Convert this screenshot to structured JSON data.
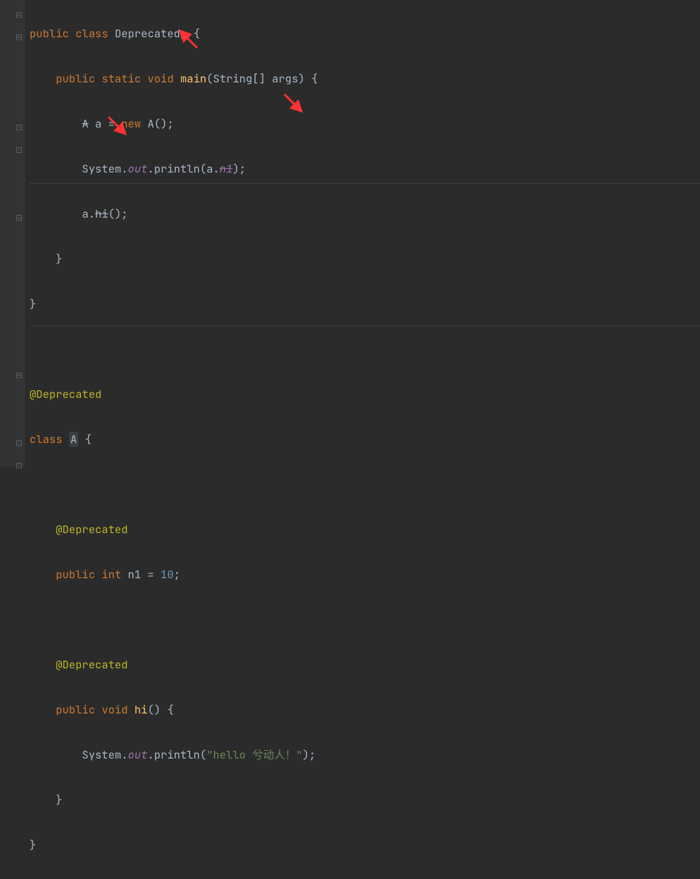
{
  "code": {
    "line1_public": "public",
    "line1_class": "class",
    "line1_name": "Deprecated_",
    "line1_brace": " {",
    "line2_public": "public",
    "line2_static": "static",
    "line2_void": "void",
    "line2_main": "main",
    "line2_paren": "(String[] args) {",
    "line3_A1": "A",
    "line3_a": " a = ",
    "line3_new": "new",
    "line3_A2": " A();",
    "line4_sys": "System.",
    "line4_out": "out",
    "line4_println": ".println(a.",
    "line4_n1": "n1",
    "line4_close": ");",
    "line5_a": "a.",
    "line5_hi": "hi",
    "line5_call": "();",
    "line6_brace": "}",
    "line7_brace": "}",
    "line9_ann": "@Deprecated",
    "line10_class": "class",
    "line10_A": "A",
    "line10_brace": " {",
    "line12_ann": "@Deprecated",
    "line13_public": "public",
    "line13_int": "int",
    "line13_n1": " n1 = ",
    "line13_val": "10",
    "line13_semi": ";",
    "line15_ann": "@Deprecated",
    "line16_public": "public",
    "line16_void": "void",
    "line16_hi": "hi",
    "line16_brace": "() {",
    "line17_sys": "System.",
    "line17_out": "out",
    "line17_println": ".println(",
    "line17_str": "\"hello 兮动人！\"",
    "line17_close": ");",
    "line18_brace": "}",
    "line19_brace": "}"
  },
  "annotations": {
    "arrow_color": "#ff3333"
  }
}
